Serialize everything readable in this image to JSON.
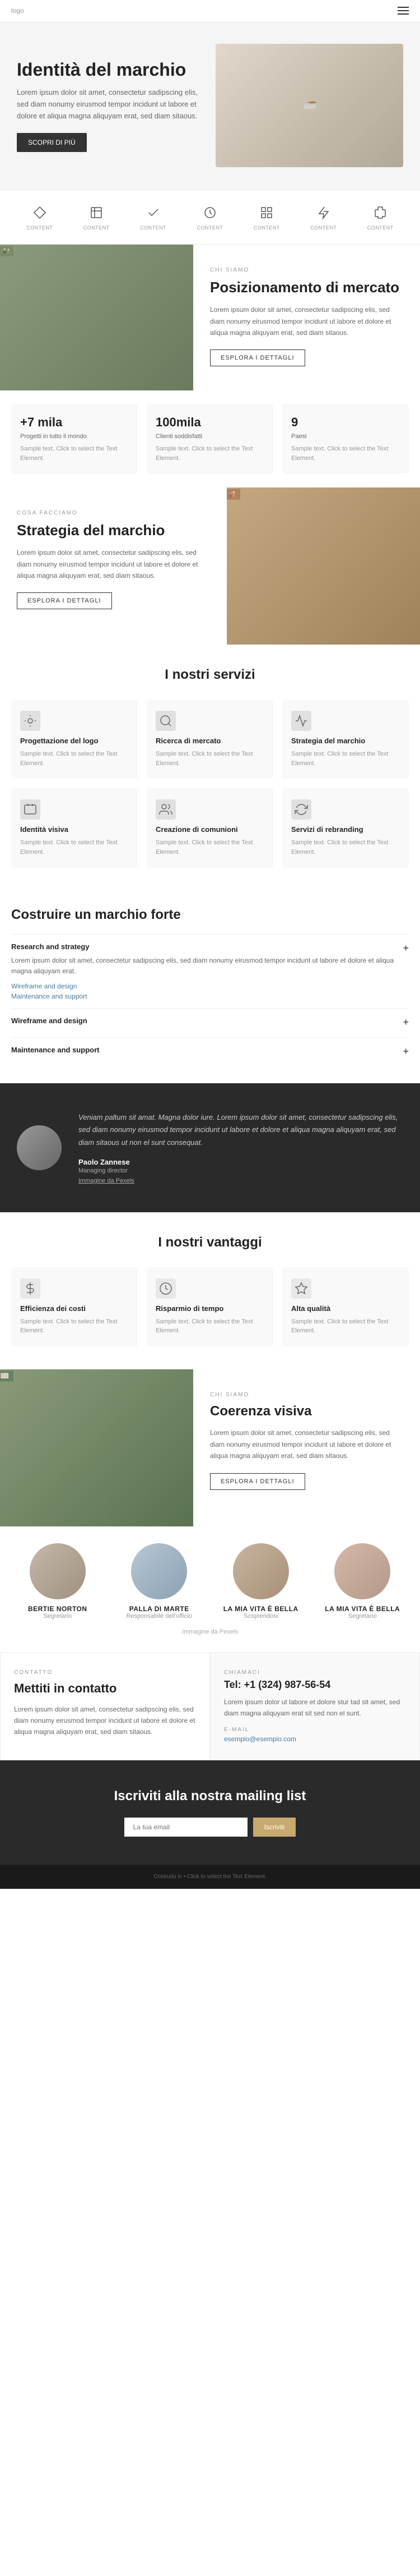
{
  "header": {
    "logo": "logo",
    "hamburger_label": "menu"
  },
  "hero": {
    "title": "Identità del marchio",
    "description": "Lorem ipsum dolor sit amet, consectetur sadipscing elis, sed diam nonumy eirusmod tempor incidunt ut labore et dolore et aliqua magna aliquyam erat, sed diam sitaous.",
    "cta_label": "SCOPRI DI PIÙ",
    "image_alt": "hero image"
  },
  "icons_row": {
    "items": [
      {
        "icon": "diamond",
        "label": "CONTENT"
      },
      {
        "icon": "book",
        "label": "CONTENT"
      },
      {
        "icon": "check",
        "label": "CONTENT"
      },
      {
        "icon": "clock",
        "label": "CONTENT"
      },
      {
        "icon": "grid",
        "label": "CONTENT"
      },
      {
        "icon": "lightning",
        "label": "CONTENT"
      },
      {
        "icon": "puzzle",
        "label": "CONTENT"
      }
    ]
  },
  "who_we_are": {
    "tag": "CHI SIAMO",
    "title": "Posizionamento di mercato",
    "description": "Lorem ipsum dolor sit amet, consectetur sadipscing elis, sed diam nonumy eirusmod tempor incidunt ut labore et dolore et aliqua magna aliquyam erat, sed diam sitaous.",
    "cta_label": "ESPLORA I DETTAGLI"
  },
  "stats": [
    {
      "number": "+7 mila",
      "label": "Progetti in tutto il mondo",
      "description": "Sample text. Click to select the Text Element."
    },
    {
      "number": "100mila",
      "label": "Clienti soddisfatti",
      "description": "Sample text. Click to select the Text Element."
    },
    {
      "number": "9",
      "label": "Paesi",
      "description": "Sample text. Click to select the Text Element."
    }
  ],
  "what_we_do": {
    "tag": "COSA FACCIAMO",
    "title": "Strategia del marchio",
    "description": "Lorem ipsum dolor sit amet, consectetur sadipscing elis, sed diam nonumy eirusmod tempor incidunt ut labore et dolore et aliqua magna aliquyam erat, sed diam sitaous.",
    "cta_label": "ESPLORA I DETTAGLI"
  },
  "services": {
    "title": "I nostri servizi",
    "items": [
      {
        "icon": "design",
        "title": "Progettazione del logo",
        "description": "Sample text. Click to select the Text Element."
      },
      {
        "icon": "research",
        "title": "Ricerca di mercato",
        "description": "Sample text. Click to select the Text Element."
      },
      {
        "icon": "strategy",
        "title": "Strategia del marchio",
        "description": "Sample text. Click to select the Text Element."
      },
      {
        "icon": "identity",
        "title": "Identità visiva",
        "description": "Sample text. Click to select the Text Element."
      },
      {
        "icon": "community",
        "title": "Creazione di comunioni",
        "description": "Sample text. Click to select the Text Element."
      },
      {
        "icon": "rebranding",
        "title": "Servizi di rebranding",
        "description": "Sample text. Click to select the Text Element."
      }
    ]
  },
  "build_brand": {
    "title": "Costruire un marchio forte",
    "items": [
      {
        "title": "Research and strategy",
        "body": "Lorem ipsum dolor sit amet, consectetur sadipscing elis, sed diam nonumy eirusmod tempor incidunt ut labore et dolore et aliqua magna aliquyam erat.",
        "links": [
          {
            "label": "Wireframe and design"
          },
          {
            "label": "Maintenance and support"
          }
        ],
        "open": true
      },
      {
        "title": "Wireframe and design",
        "body": "",
        "links": [],
        "open": false
      },
      {
        "title": "Maintenance and support",
        "body": "",
        "links": [],
        "open": false
      }
    ]
  },
  "testimonial": {
    "text": "Veniam paltum sit amat. Magna dolor iure. Lorem ipsum dolor sit amet, consectetur sadipscing elis, sed diam nonumy eirusmod tempor incidunt ut labore et dolore et aliqua magna aliquyam erat, sed diam sitaous ut non el sunt consequat.",
    "name": "Paolo Zannese",
    "role": "Managing director",
    "link_label": "Immagine da Pexels"
  },
  "benefits": {
    "title": "I nostri vantaggi",
    "items": [
      {
        "icon": "efficiency",
        "title": "Efficienza dei costi",
        "description": "Sample text. Click to select the Text Element."
      },
      {
        "icon": "time",
        "title": "Risparmio di tempo",
        "description": "Sample text. Click to select the Text Element."
      },
      {
        "icon": "quality",
        "title": "Alta qualità",
        "description": "Sample text. Click to select the Text Element."
      }
    ]
  },
  "coherence": {
    "tag": "CHI SIAMO",
    "title": "Coerenza visiva",
    "description": "Lorem ipsum dolor sit amet, consectetur sadipscing elis, sed diam nonumy eirusmod tempor incidunt ut labore et dolore et aliqua magna aliquyam erat, sed diam sitaous.",
    "cta_label": "ESPLORA I DETTAGLI"
  },
  "team": {
    "members": [
      {
        "name": "BERTIE NORTON",
        "role": "Segretario"
      },
      {
        "name": "PALLA DI MARTE",
        "role": "Responsabile dell'ufficio"
      },
      {
        "name": "LA MIA VITA È BELLA",
        "role": "Scoprendosi"
      },
      {
        "name": "LA MIA VITA È BELLA",
        "role": "Segretario"
      }
    ],
    "caption": "Immagine da Pexels"
  },
  "contact": {
    "tag": "CONTATTO",
    "title": "Mettiti in contatto",
    "description": "Lorem ipsum dolor sit amet, consectetur sadipscing elis, sed diam nonumy eirusmod tempor incidunt ut labore et dolore et aliqua magna aliquyam erat, sed diam sitaous.",
    "phone_tag": "CHIAMACI",
    "phone": "Tel: +1 (324) 987-56-54",
    "phone_description": "Lorem ipsum dolor ut labore et dolore stur tad sit amet, sed diam magna aliquyam erat sit sed non el sunt.",
    "email_tag": "E-MAIL",
    "email": "esempio@esempio.com"
  },
  "newsletter": {
    "title": "Iscriviti alla nostra mailing list",
    "input_placeholder": "La tua email",
    "cta_label": "Iscriviti",
    "footer_text": "Costruito in • Click to select the Text Element."
  }
}
